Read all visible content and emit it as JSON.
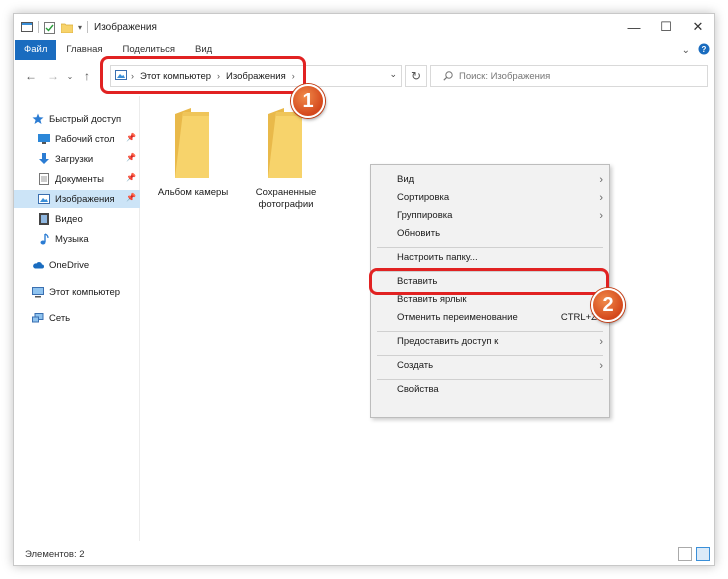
{
  "window": {
    "title": "Изображения",
    "controls": {
      "minimize": "—",
      "maximize": "☐",
      "close": "✕"
    }
  },
  "ribbon": {
    "tabs": [
      "Файл",
      "Главная",
      "Поделиться",
      "Вид"
    ],
    "collapse_glyph": "⌄",
    "help_glyph": "?"
  },
  "address": {
    "crumbs": [
      "Этот компьютер",
      "Изображения"
    ],
    "search_placeholder": "Поиск: Изображения"
  },
  "sidebar": {
    "items": [
      {
        "label": "Быстрый доступ",
        "icon": "star-icon"
      },
      {
        "label": "Рабочий стол",
        "icon": "desktop-icon",
        "pinned": true
      },
      {
        "label": "Загрузки",
        "icon": "download-icon",
        "pinned": true
      },
      {
        "label": "Документы",
        "icon": "document-icon",
        "pinned": true
      },
      {
        "label": "Изображения",
        "icon": "pictures-icon",
        "pinned": true,
        "selected": true
      },
      {
        "label": "Видео",
        "icon": "video-icon"
      },
      {
        "label": "Музыка",
        "icon": "music-icon"
      },
      {
        "label": "OneDrive",
        "icon": "cloud-icon"
      },
      {
        "label": "Этот компьютер",
        "icon": "computer-icon"
      },
      {
        "label": "Сеть",
        "icon": "network-icon"
      }
    ]
  },
  "folders": [
    {
      "label": "Альбом камеры"
    },
    {
      "label": "Сохраненные фотографии"
    }
  ],
  "context_menu": {
    "items": [
      {
        "label": "Вид",
        "submenu": true
      },
      {
        "label": "Сортировка",
        "submenu": true
      },
      {
        "label": "Группировка",
        "submenu": true
      },
      {
        "label": "Обновить"
      },
      {
        "label": "Настроить папку..."
      },
      {
        "label": "Вставить"
      },
      {
        "label": "Вставить ярлык"
      },
      {
        "label": "Отменить переименование",
        "shortcut": "CTRL+Z"
      },
      {
        "label": "Предоставить доступ к",
        "submenu": true
      },
      {
        "label": "Создать",
        "submenu": true
      },
      {
        "label": "Свойства"
      }
    ]
  },
  "annotations": {
    "badge_1": "1",
    "badge_2": "2"
  },
  "status": {
    "items_text": "Элементов: 2"
  },
  "colors": {
    "accent": "#1a6cbf",
    "selection": "#cce4f7",
    "highlight": "#e12222",
    "badge": "#d4481c",
    "folder": "#f7d36b"
  }
}
